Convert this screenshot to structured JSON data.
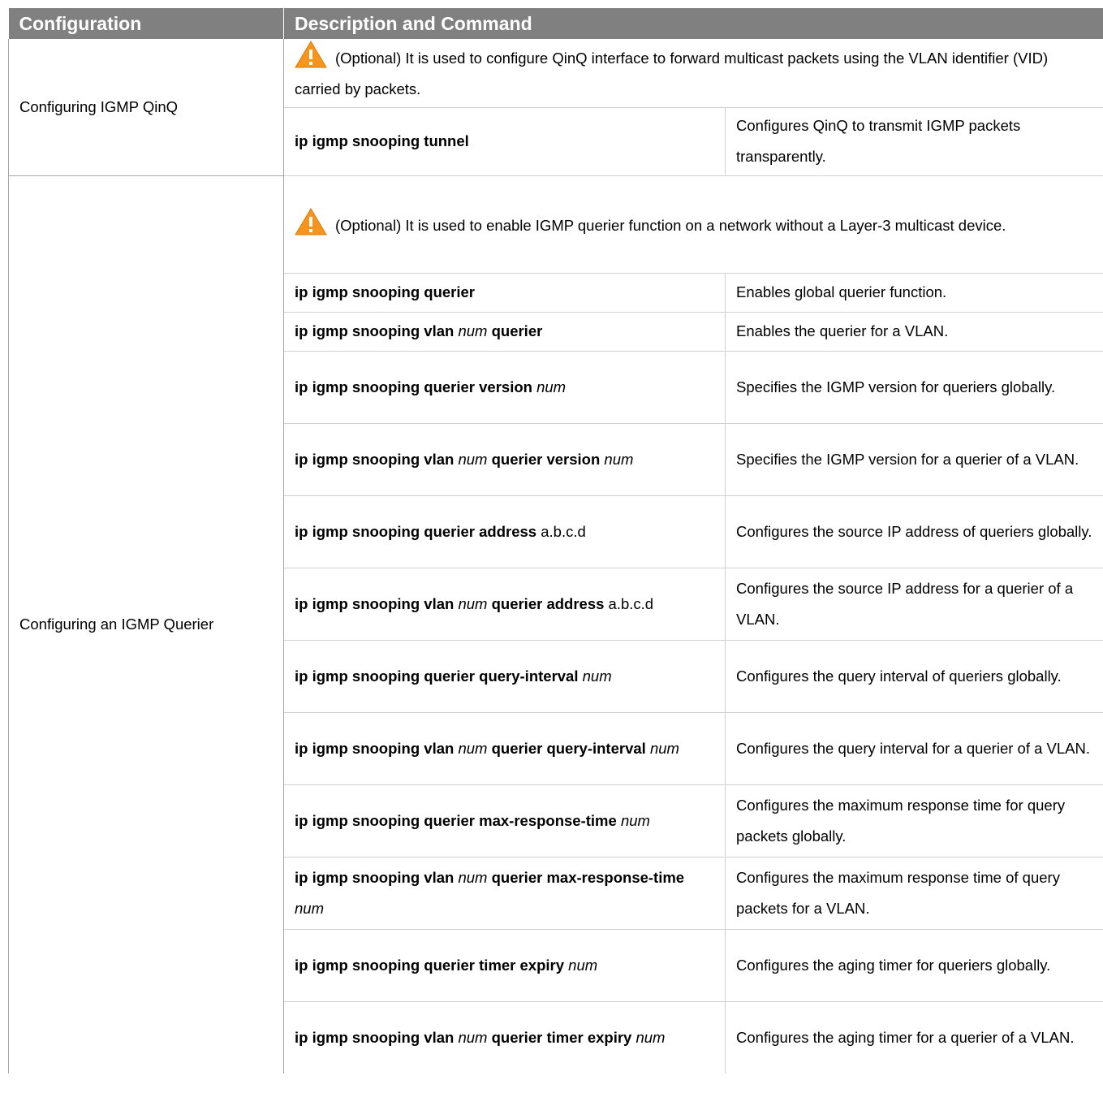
{
  "header": {
    "col1": "Configuration",
    "col2": "Description and Command"
  },
  "icons": {
    "warning": "warning-triangle-icon"
  },
  "colors": {
    "header_bg": "#808080",
    "header_text": "#ffffff",
    "warning_icon": "#f7941d"
  },
  "sections": [
    {
      "config": "Configuring IGMP QinQ",
      "note": "(Optional) It is used to configure QinQ interface to forward multicast packets using the VLAN identifier (VID) carried by packets.",
      "rows": [
        {
          "cmd": [
            {
              "t": "ip igmp snooping tunnel",
              "s": "b"
            }
          ],
          "desc": "Configures QinQ to transmit IGMP packets transparently."
        }
      ]
    },
    {
      "config": "Configuring an IGMP Querier",
      "note": "(Optional) It is used to enable IGMP querier function on a network without a Layer-3 multicast device.",
      "rows": [
        {
          "cmd": [
            {
              "t": "ip igmp snooping querier",
              "s": "b"
            }
          ],
          "desc": "Enables global querier function."
        },
        {
          "cmd": [
            {
              "t": "ip igmp snooping vlan",
              "s": "b"
            },
            {
              "t": " "
            },
            {
              "t": "num",
              "s": "i"
            },
            {
              "t": " "
            },
            {
              "t": "querier",
              "s": "b"
            }
          ],
          "desc": "Enables the querier for a VLAN."
        },
        {
          "cmd": [
            {
              "t": "ip igmp snooping querier version",
              "s": "b"
            },
            {
              "t": " "
            },
            {
              "t": "num",
              "s": "i"
            }
          ],
          "desc": "Specifies the IGMP version for queriers globally."
        },
        {
          "cmd": [
            {
              "t": "ip igmp snooping vlan",
              "s": "b"
            },
            {
              "t": " "
            },
            {
              "t": "num",
              "s": "i"
            },
            {
              "t": " "
            },
            {
              "t": "querier version",
              "s": "b"
            },
            {
              "t": " "
            },
            {
              "t": "num",
              "s": "i"
            }
          ],
          "desc": "Specifies the IGMP version for a querier of a VLAN."
        },
        {
          "cmd": [
            {
              "t": "ip igmp snooping querier address",
              "s": "b"
            },
            {
              "t": " a.b.c.d"
            }
          ],
          "desc": "Configures the source IP address of queriers globally."
        },
        {
          "cmd": [
            {
              "t": "ip igmp snooping vlan",
              "s": "b"
            },
            {
              "t": " "
            },
            {
              "t": "num",
              "s": "i"
            },
            {
              "t": " "
            },
            {
              "t": "querier address",
              "s": "b"
            },
            {
              "t": " a.b.c.d"
            }
          ],
          "desc": "Configures the source IP address for a querier of a VLAN."
        },
        {
          "cmd": [
            {
              "t": "ip igmp snooping querier query-interval",
              "s": "b"
            },
            {
              "t": " "
            },
            {
              "t": "num",
              "s": "i"
            }
          ],
          "desc": "Configures the query interval of queriers globally."
        },
        {
          "cmd": [
            {
              "t": "ip igmp snooping vlan",
              "s": "b"
            },
            {
              "t": " "
            },
            {
              "t": "num",
              "s": "i"
            },
            {
              "t": " "
            },
            {
              "t": "querier query-interval",
              "s": "b"
            },
            {
              "t": " "
            },
            {
              "t": "num",
              "s": "i"
            }
          ],
          "desc": "Configures the query interval for a querier of a VLAN."
        },
        {
          "cmd": [
            {
              "t": "ip igmp snooping querier max-response-time",
              "s": "b"
            },
            {
              "t": " "
            },
            {
              "t": "num",
              "s": "i"
            }
          ],
          "desc": "Configures the maximum response time for query packets globally."
        },
        {
          "cmd": [
            {
              "t": "ip igmp snooping vlan",
              "s": "b"
            },
            {
              "t": " "
            },
            {
              "t": "num",
              "s": "i"
            },
            {
              "t": " "
            },
            {
              "t": "querier max-response-time",
              "s": "b"
            },
            {
              "t": " "
            },
            {
              "t": "num",
              "s": "i"
            }
          ],
          "desc": "Configures the maximum response time of query packets for a VLAN."
        },
        {
          "cmd": [
            {
              "t": "ip igmp snooping querier timer expiry",
              "s": "b"
            },
            {
              "t": " "
            },
            {
              "t": "num",
              "s": "i"
            }
          ],
          "desc": "Configures the aging timer for queriers globally."
        },
        {
          "cmd": [
            {
              "t": "ip igmp snooping vlan",
              "s": "b"
            },
            {
              "t": " "
            },
            {
              "t": "num",
              "s": "i"
            },
            {
              "t": " "
            },
            {
              "t": "querier timer expiry",
              "s": "b"
            },
            {
              "t": " "
            },
            {
              "t": "num",
              "s": "i"
            }
          ],
          "desc": "Configures the aging timer for a querier of a VLAN."
        }
      ]
    }
  ]
}
